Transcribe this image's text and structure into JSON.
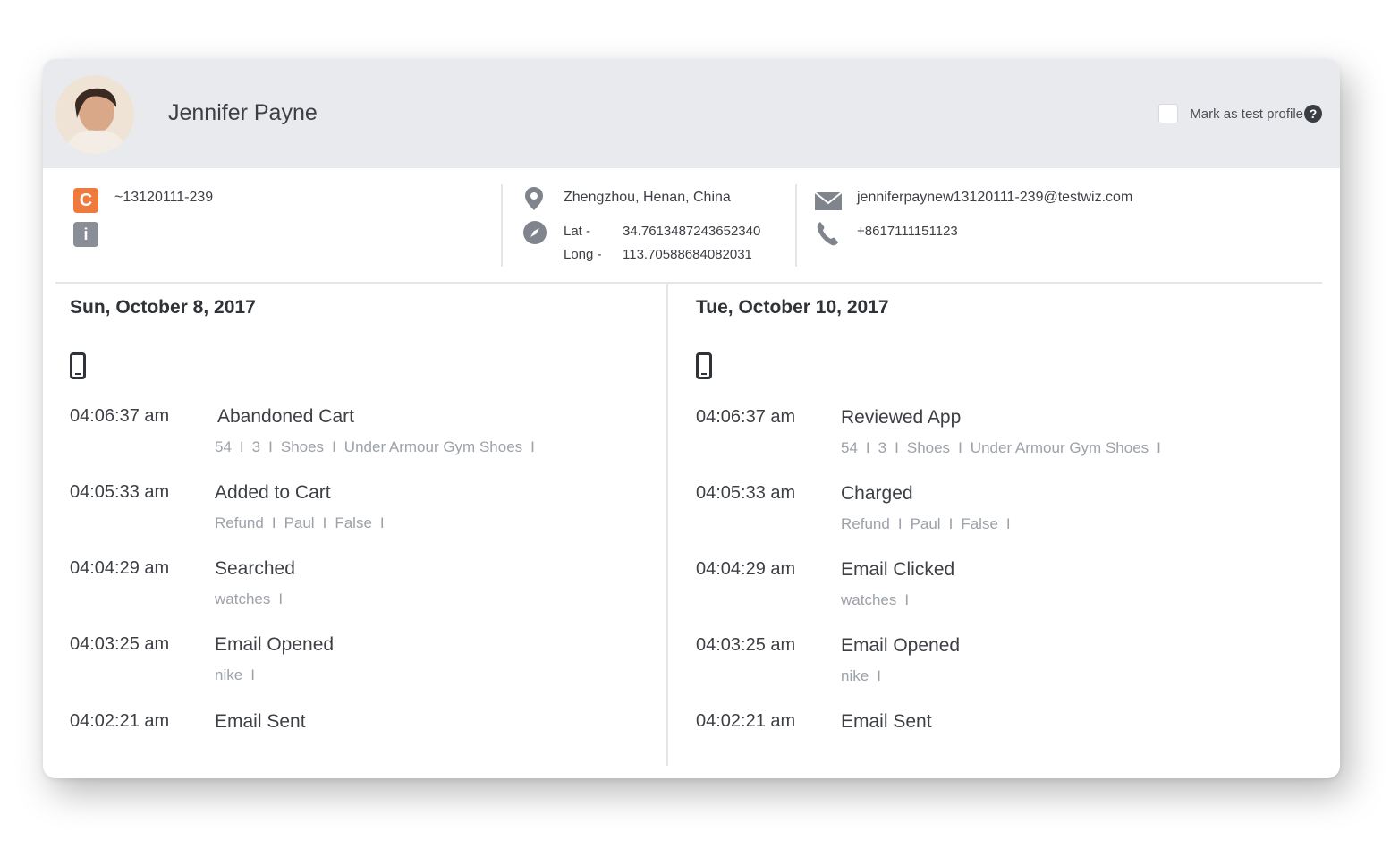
{
  "profile": {
    "name": "Jennifer Payne",
    "test_profile_label": "Mark as test profile",
    "help_glyph": "?"
  },
  "identity": {
    "badge_letter": "C",
    "info_glyph": "i",
    "id": "~13120111-239"
  },
  "location": {
    "place": "Zhengzhou, Henan, China",
    "lat_label": "Lat -",
    "lat": "34.7613487243652340",
    "long_label": "Long -",
    "long": "113.70588684082031"
  },
  "contact": {
    "email": "jenniferpaynew13120111-239@testwiz.com",
    "phone": "+8617111151123"
  },
  "icons": {
    "location": "location-pin-icon",
    "coordinates": "compass-icon",
    "email": "mail-icon",
    "phone": "phone-icon",
    "device": "mobile-device-icon"
  },
  "colors": {
    "header_bg": "#e8eaed",
    "badge_c": "#ef7a3d",
    "badge_i": "#8a8f97"
  },
  "days": [
    {
      "date": "Sun, October 8, 2017",
      "events": [
        {
          "time": "04:06:37 am",
          "name": "Abandoned Cart",
          "props": [
            "54",
            "3",
            "Shoes",
            "Under Armour Gym Shoes"
          ]
        },
        {
          "time": "04:05:33 am",
          "name": "Added to Cart",
          "props": [
            "Refund",
            "Paul",
            "False"
          ]
        },
        {
          "time": "04:04:29 am",
          "name": "Searched",
          "props": [
            "watches"
          ]
        },
        {
          "time": "04:03:25 am",
          "name": "Email Opened",
          "props": [
            "nike"
          ]
        },
        {
          "time": "04:02:21 am",
          "name": "Email Sent",
          "props": []
        }
      ]
    },
    {
      "date": "Tue, October 10, 2017",
      "events": [
        {
          "time": "04:06:37 am",
          "name": "Reviewed App",
          "props": [
            "54",
            "3",
            "Shoes",
            "Under Armour Gym Shoes"
          ]
        },
        {
          "time": "04:05:33 am",
          "name": "Charged",
          "props": [
            "Refund",
            "Paul",
            "False"
          ]
        },
        {
          "time": "04:04:29 am",
          "name": "Email Clicked",
          "props": [
            "watches"
          ]
        },
        {
          "time": "04:03:25 am",
          "name": "Email Opened",
          "props": [
            "nike"
          ]
        },
        {
          "time": "04:02:21 am",
          "name": "Email Sent",
          "props": []
        }
      ]
    }
  ]
}
